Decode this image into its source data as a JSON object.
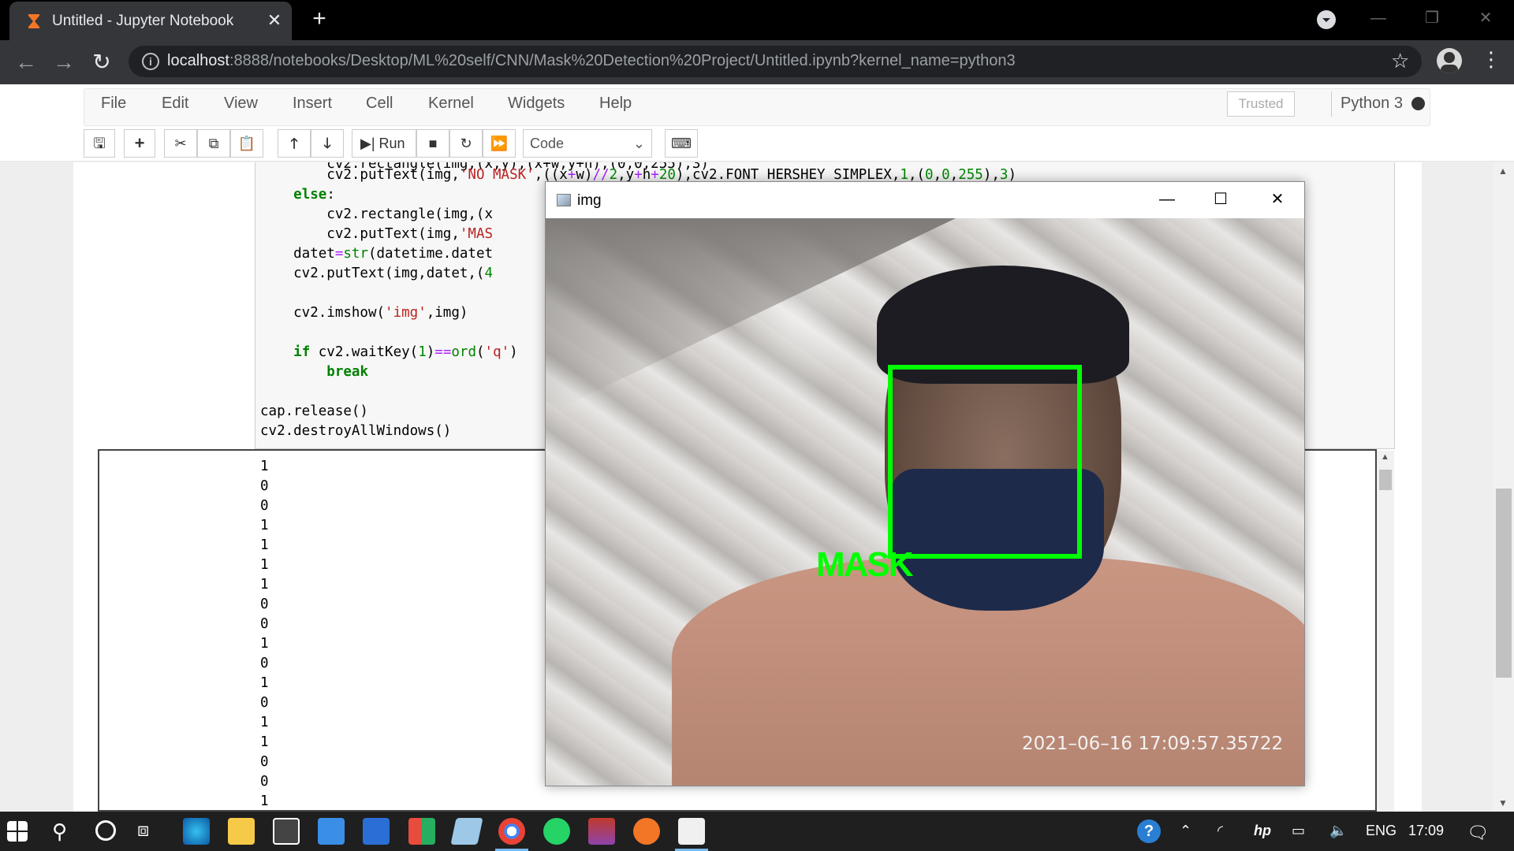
{
  "browser": {
    "tab_title": "Untitled - Jupyter Notebook",
    "url_host": "localhost",
    "url_rest": ":8888/notebooks/Desktop/ML%20self/CNN/Mask%20Detection%20Project/Untitled.ipynb?kernel_name=python3"
  },
  "jupyter": {
    "menu": [
      "File",
      "Edit",
      "View",
      "Insert",
      "Cell",
      "Kernel",
      "Widgets",
      "Help"
    ],
    "trusted": "Trusted",
    "kernel": "Python 3",
    "run_label": "Run",
    "cell_type": "Code"
  },
  "code_lines": [
    "        cv2.putText(img,'NO MASK',((x+w)//2,y+h+20),cv2.FONT_HERSHEY_SIMPLEX,1,(0,0,255),3)",
    "    else:",
    "        cv2.rectangle(img,(x",
    "        cv2.putText(img,'MAS",
    "    datet=str(datetime.datet",
    "    cv2.putText(img,datet,(4",
    "",
    "    cv2.imshow('img',img)",
    "",
    "    if cv2.waitKey(1)==ord('q')",
    "        break",
    "",
    "cap.release()",
    "cv2.destroyAllWindows()"
  ],
  "output_lines": [
    "1",
    "0",
    "0",
    "1",
    "1",
    "1",
    "1",
    "0",
    "0",
    "1",
    "0",
    "1",
    "0",
    "1",
    "1",
    "0",
    "0",
    "1"
  ],
  "img_window": {
    "title": "img",
    "label": "MASK",
    "timestamp": "2021–06–16  17:09:57.35722"
  },
  "taskbar": {
    "lang": "ENG",
    "time": "17:09"
  },
  "colors": {
    "box": "#00ff00",
    "chrome_dark": "#35363a",
    "taskbar": "#1f1f1f"
  }
}
